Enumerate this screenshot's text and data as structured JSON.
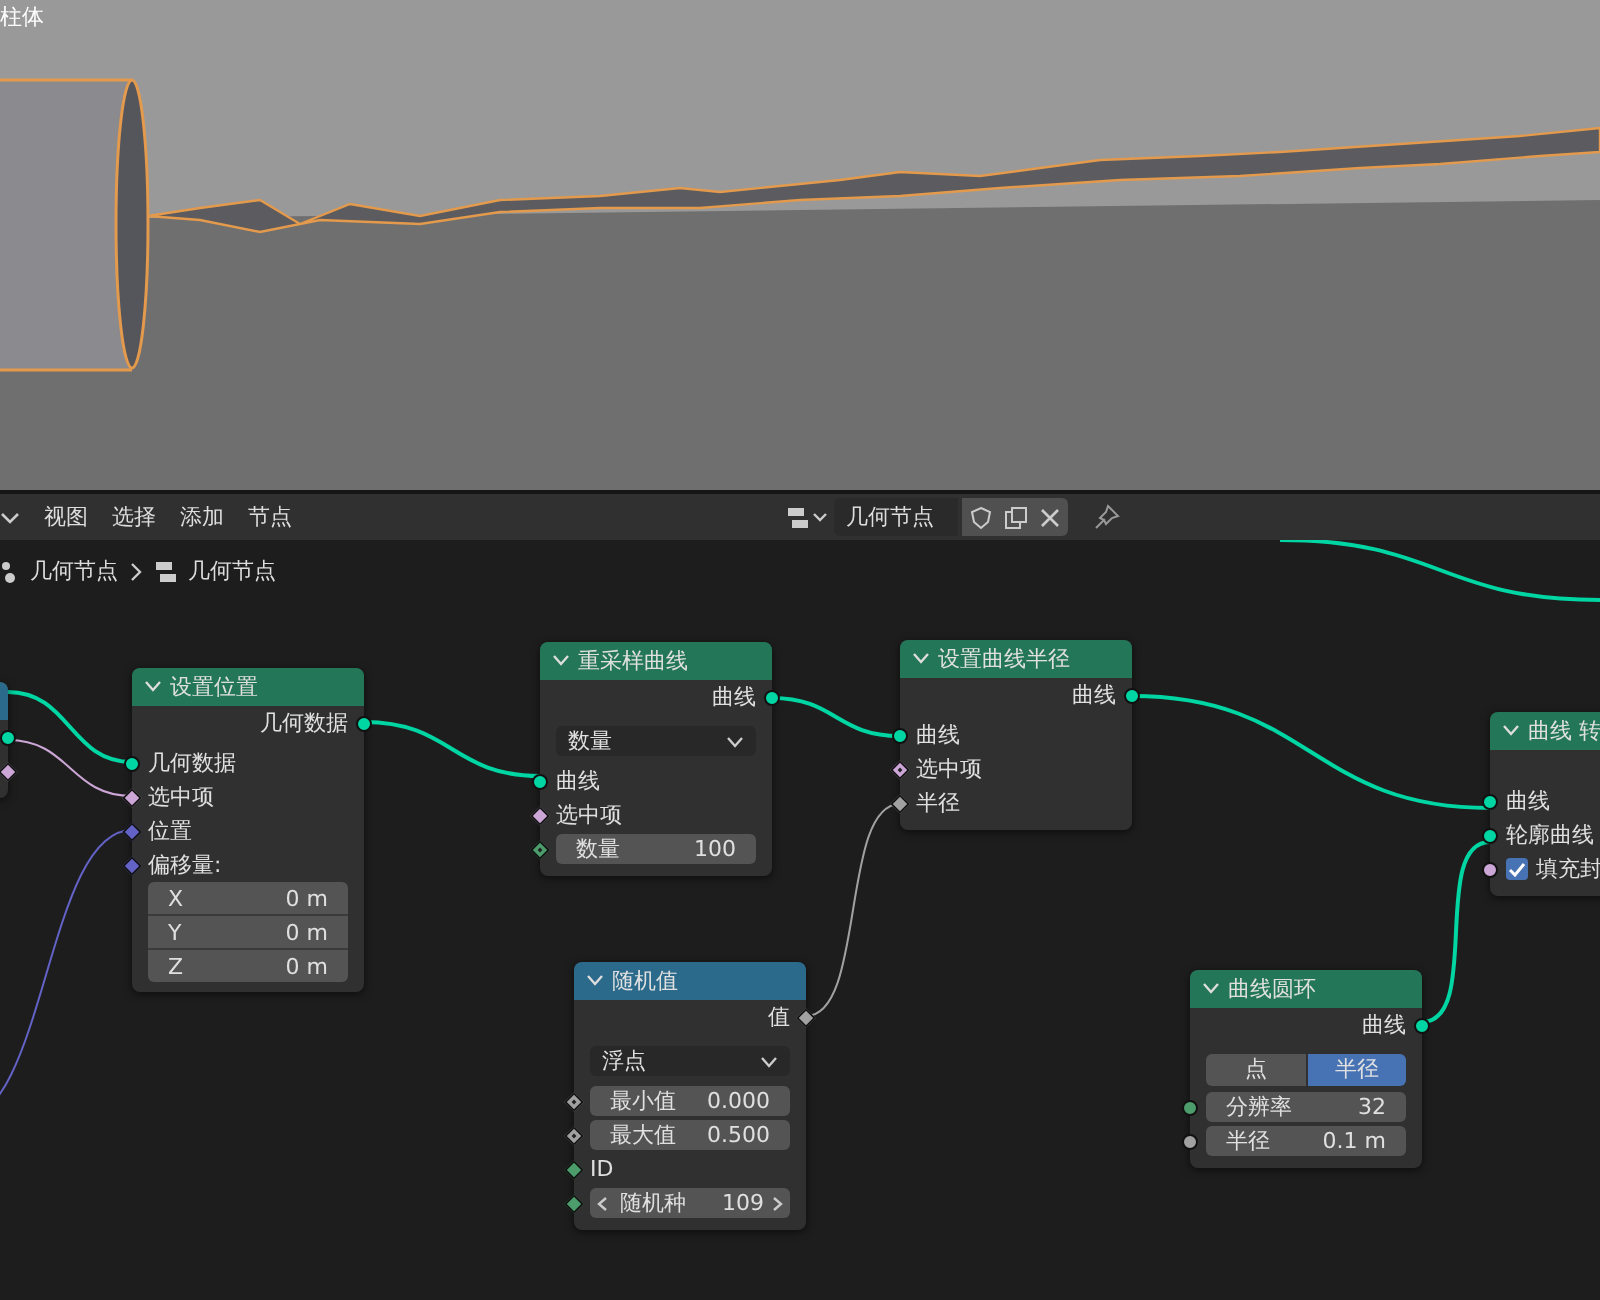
{
  "viewport": {
    "object_label": "柱体"
  },
  "header": {
    "menus": [
      "视图",
      "选择",
      "添加",
      "节点"
    ],
    "node_tree": "几何节点"
  },
  "breadcrumb": [
    "几何节点",
    "几何节点"
  ],
  "nodes": [
    {
      "color": "#2b6a8a",
      "rows": [
        {
          "kind": "output",
          "socket": {
            "kind": "circle",
            "color": "#00d6a3"
          }
        },
        {
          "kind": "output",
          "socket": {
            "kind": "diamond",
            "color": "#cca6d6"
          }
        }
      ]
    },
    {
      "title": "设置位置",
      "color": "#237658",
      "rows": [
        {
          "kind": "output",
          "label": "几何数据",
          "socket": {
            "kind": "circle",
            "color": "#00d6a3"
          }
        },
        {
          "kind": "input",
          "label": "几何数据",
          "socket": {
            "kind": "circle",
            "color": "#00d6a3"
          }
        },
        {
          "kind": "input",
          "label": "选中项",
          "socket": {
            "kind": "diamond",
            "color": "#cca6d6"
          }
        },
        {
          "kind": "input",
          "label": "位置",
          "socket": {
            "kind": "diamond",
            "color": "#6363c7"
          }
        },
        {
          "kind": "input",
          "label": "偏移量:",
          "socket": {
            "kind": "diamond",
            "color": "#6363c7"
          }
        },
        {
          "kind": "vector",
          "fields": [
            {
              "label": "X",
              "value": "0 m"
            },
            {
              "label": "Y",
              "value": "0 m"
            },
            {
              "label": "Z",
              "value": "0 m"
            }
          ]
        }
      ]
    },
    {
      "title": "重采样曲线",
      "color": "#237658",
      "rows": [
        {
          "kind": "output",
          "label": "曲线",
          "socket": {
            "kind": "circle",
            "color": "#00d6a3"
          }
        },
        {
          "kind": "dropdown",
          "value": "数量"
        },
        {
          "kind": "input",
          "label": "曲线",
          "socket": {
            "kind": "circle",
            "color": "#00d6a3"
          }
        },
        {
          "kind": "input",
          "label": "选中项",
          "socket": {
            "kind": "diamond",
            "color": "#cca6d6"
          }
        },
        {
          "kind": "field",
          "label": "数量",
          "value": "100",
          "socket": {
            "kind": "diamond_dot",
            "color": "#4c9c6c"
          }
        }
      ]
    },
    {
      "title": "设置曲线半径",
      "color": "#237658",
      "rows": [
        {
          "kind": "output",
          "label": "曲线",
          "socket": {
            "kind": "circle",
            "color": "#00d6a3"
          }
        },
        {
          "kind": "input",
          "label": "曲线",
          "socket": {
            "kind": "circle",
            "color": "#00d6a3"
          }
        },
        {
          "kind": "input",
          "label": "选中项",
          "socket": {
            "kind": "diamond_dot",
            "color": "#cca6d6"
          }
        },
        {
          "kind": "input",
          "label": "半径",
          "socket": {
            "kind": "diamond",
            "color": "#a1a1a1"
          }
        }
      ]
    },
    {
      "title": "曲线 转",
      "color": "#237658",
      "rows": [
        {
          "kind": "spacer"
        },
        {
          "kind": "input",
          "label": "曲线",
          "socket": {
            "kind": "circle",
            "color": "#00d6a3"
          }
        },
        {
          "kind": "input",
          "label": "轮廓曲线",
          "socket": {
            "kind": "circle",
            "color": "#00d6a3"
          }
        },
        {
          "kind": "checkbox",
          "label": "填充封",
          "checked": true,
          "socket": {
            "kind": "circle",
            "color": "#cca6d6"
          }
        }
      ]
    },
    {
      "title": "随机值",
      "color": "#2b6a8a",
      "rows": [
        {
          "kind": "output",
          "label": "值",
          "socket": {
            "kind": "diamond",
            "color": "#a1a1a1"
          }
        },
        {
          "kind": "dropdown",
          "value": "浮点"
        },
        {
          "kind": "field",
          "label": "最小值",
          "value": "0.000",
          "socket": {
            "kind": "diamond_dot",
            "color": "#a1a1a1"
          }
        },
        {
          "kind": "field",
          "label": "最大值",
          "value": "0.500",
          "socket": {
            "kind": "diamond_dot",
            "color": "#a1a1a1"
          }
        },
        {
          "kind": "input",
          "label": "ID",
          "socket": {
            "kind": "diamond",
            "color": "#4c9c6c"
          }
        },
        {
          "kind": "stepper",
          "label": "随机种",
          "value": "109",
          "socket": {
            "kind": "diamond",
            "color": "#4c9c6c"
          }
        }
      ]
    },
    {
      "title": "曲线圆环",
      "color": "#237658",
      "rows": [
        {
          "kind": "output",
          "label": "曲线",
          "socket": {
            "kind": "circle",
            "color": "#00d6a3"
          }
        },
        {
          "kind": "segmented",
          "options": [
            {
              "label": "点",
              "selected": false
            },
            {
              "label": "半径",
              "selected": true
            }
          ]
        },
        {
          "kind": "field",
          "label": "分辨率",
          "value": "32",
          "socket": {
            "kind": "circle",
            "color": "#4c9c6c"
          }
        },
        {
          "kind": "field",
          "label": "半径",
          "value": "0.1 m",
          "socket": {
            "kind": "circle",
            "color": "#a1a1a1"
          }
        }
      ]
    }
  ]
}
